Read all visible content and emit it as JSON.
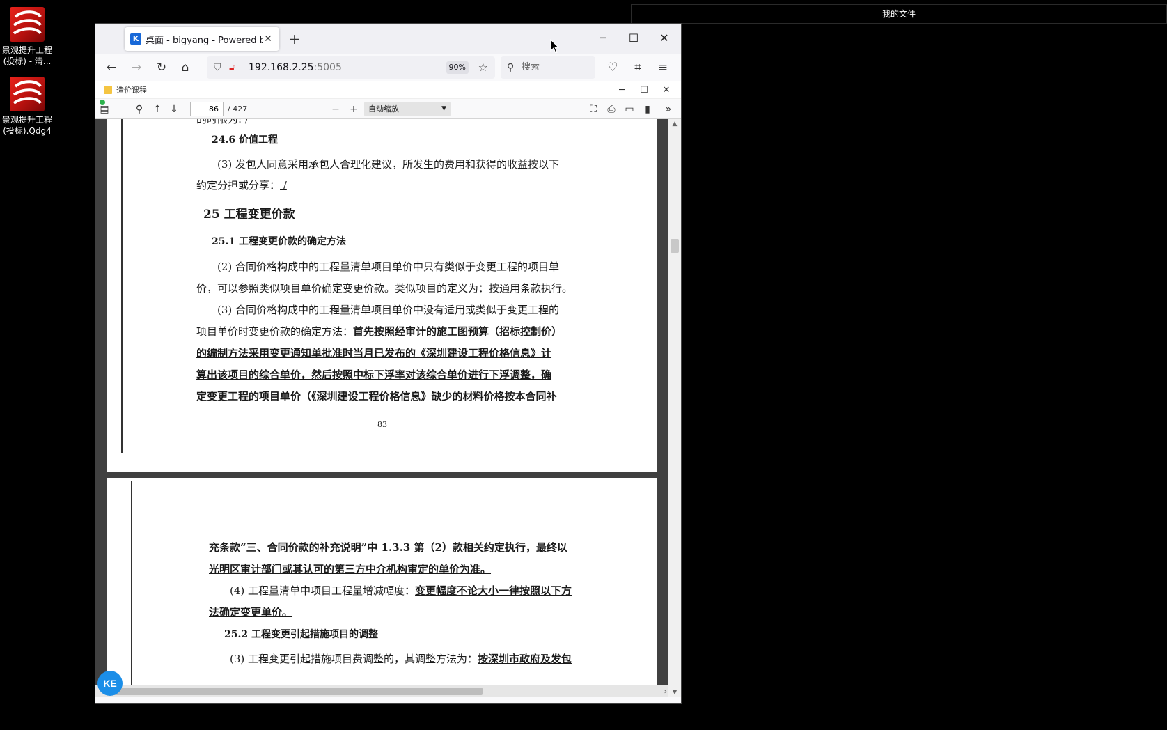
{
  "desktop": {
    "icons": [
      {
        "label_line1": "景观提升工程",
        "label_line2": "(投标) - 清..."
      },
      {
        "label_line1": "景观提升工程",
        "label_line2": "(投标).Qdg4"
      }
    ],
    "topbar_title": "我的文件"
  },
  "browser": {
    "tab_title": "桌面 - bigyang - Powered by",
    "tab_favicon": "K",
    "url_host": "192.168.2.25",
    "url_port": ":5005",
    "zoom": "90%",
    "search_placeholder": "搜索"
  },
  "viewer": {
    "title": "造价课程",
    "page_number": "86",
    "page_count": "/ 427",
    "zoom_mode": "自动缩放"
  },
  "page1": {
    "line_top_fragment": "的时限为: /",
    "h_24_6": "24.6 价值工程",
    "p1_line1": "(3) 发包人同意采用承包人合理化建议，所发生的费用和获得的收益按以下",
    "p1_line2_a": "约定分担或分享：",
    "p1_line2_b": "  /",
    "h_25": "25 工程变更价款",
    "h_25_1": "25.1 工程变更价款的确定方法",
    "p2_line1": "(2) 合同价格构成中的工程量清单项目单价中只有类似于变更工程的项目单",
    "p2_line2_a": "价，可以参照类似项目单价确定变更价款。类似项目的定义为：",
    "p2_line2_b": "按通用条款执行。",
    "p3_line1": "(3) 合同价格构成中的工程量清单项目单价中没有适用或类似于变更工程的",
    "p3_line2_a": "项目单价时变更价款的确定方法：",
    "p3_line2_b": "首先按照经审计的施工图预算（招标控制价）",
    "p3_line3": "的编制方法采用变更通知单批准时当月已发布的《深圳建设工程价格信息》计",
    "p3_line4": "算出该项目的综合单价，然后按照中标下浮率对该综合单价进行下浮调整，确",
    "p3_line5": "定变更工程的项目单价（《深圳建设工程价格信息》缺少的材料价格按本合同补",
    "page_no": "83"
  },
  "page2": {
    "l1": "充条款“三、合同价款的补充说明”中 1.3.3 第（2）款相关约定执行，最终以",
    "l2": "光明区审计部门或其认可的第三方中介机构审定的单价为准。",
    "l3_a": "(4) 工程量清单中项目工程量增减幅度：",
    "l3_b": "变更幅度不论大小一律按照以下方",
    "l4": "法确定变更单价。",
    "h_25_2": "25.2 工程变更引起措施项目的调整",
    "l5_a": "(3) 工程变更引起措施项目费调整的，其调整方法为：",
    "l5_b": "按深圳市政府及发包"
  },
  "badge": "KE"
}
